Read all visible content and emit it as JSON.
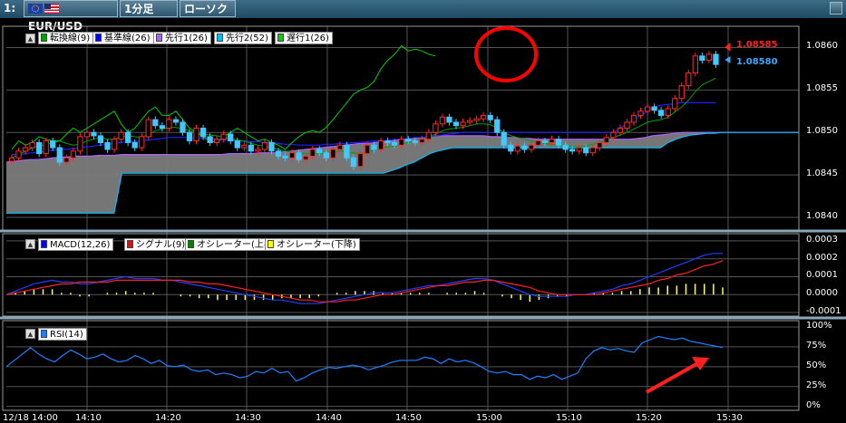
{
  "toolbar": {
    "window_index": "1:",
    "symbol": "EUR/USD",
    "timeframe": "1分足",
    "chart_style": "ローソク"
  },
  "chart_data": [
    {
      "type": "candlestick",
      "title": "EUR/USD",
      "ylim": [
        1.08385,
        1.08625
      ],
      "yticks": [
        "1.0860",
        "1.0855",
        "1.0850",
        "1.0845",
        "1.0840"
      ],
      "x_ticks": [
        "12/18 14:00",
        "14:10",
        "14:20",
        "14:30",
        "14:40",
        "14:50",
        "15:00",
        "15:10",
        "15:20",
        "15:30"
      ],
      "legend": [
        {
          "name": "転換線(9)",
          "color": "#00a000"
        },
        {
          "name": "基準線(26)",
          "color": "#0000ff"
        },
        {
          "name": "先行1(26)",
          "color": "#b060ff"
        },
        {
          "name": "先行2(52)",
          "color": "#00c0ff"
        },
        {
          "name": "遅行1(26)",
          "color": "#00d000"
        }
      ],
      "price_labels": [
        {
          "text": "1.08585",
          "color": "#ff2020"
        },
        {
          "text": "1.08580",
          "color": "#3aa8ff"
        }
      ],
      "close": [
        1.0847,
        1.08478,
        1.08482,
        1.08488,
        1.08475,
        1.0849,
        1.08482,
        1.08465,
        1.0847,
        1.08478,
        1.08495,
        1.085,
        1.08496,
        1.08488,
        1.0848,
        1.08492,
        1.085,
        1.08488,
        1.08482,
        1.08495,
        1.08515,
        1.08508,
        1.08505,
        1.08515,
        1.08512,
        1.085,
        1.0849,
        1.08505,
        1.08495,
        1.08488,
        1.08492,
        1.08498,
        1.0849,
        1.08482,
        1.08485,
        1.08478,
        1.0848,
        1.08488,
        1.08478,
        1.08472,
        1.0847,
        1.08476,
        1.08468,
        1.08472,
        1.0848,
        1.08476,
        1.0847,
        1.0848,
        1.08485,
        1.0847,
        1.0846,
        1.08475,
        1.08485,
        1.0848,
        1.0849,
        1.08488,
        1.08485,
        1.08492,
        1.0849,
        1.08488,
        1.08492,
        1.085,
        1.0851,
        1.08518,
        1.08512,
        1.08508,
        1.08512,
        1.08514,
        1.08516,
        1.0852,
        1.08515,
        1.085,
        1.08485,
        1.08478,
        1.08484,
        1.0848,
        1.08485,
        1.0849,
        1.08488,
        1.08492,
        1.08485,
        1.0848,
        1.08478,
        1.08482,
        1.08476,
        1.08482,
        1.08488,
        1.08494,
        1.085,
        1.08505,
        1.08512,
        1.0852,
        1.08525,
        1.0853,
        1.08526,
        1.0852,
        1.08528,
        1.0854,
        1.08555,
        1.0857,
        1.0859,
        1.08585,
        1.08592,
        1.0858
      ],
      "tenkan": [
        1.0847,
        1.08474,
        1.08478,
        1.08482,
        1.08484,
        1.08486,
        1.08488,
        1.0849,
        1.08487,
        1.08485,
        1.08486,
        1.0849,
        1.08492,
        1.08494,
        1.08492,
        1.08492,
        1.08495,
        1.08496,
        1.08495,
        1.08494,
        1.08498,
        1.08502,
        1.08504,
        1.08506,
        1.08506,
        1.08504,
        1.08502,
        1.085,
        1.08498,
        1.08497,
        1.08496,
        1.08494,
        1.08493,
        1.08491,
        1.0849,
        1.08487,
        1.08485,
        1.08484,
        1.08482,
        1.0848,
        1.08478,
        1.08477,
        1.08476,
        1.08475,
        1.08475,
        1.08475,
        1.08476,
        1.08477,
        1.08478,
        1.08477,
        1.08476,
        1.08475,
        1.08477,
        1.08479,
        1.08481,
        1.08483,
        1.08484,
        1.08486,
        1.08488,
        1.0849,
        1.08492,
        1.08494,
        1.08498,
        1.08502,
        1.08504,
        1.08505,
        1.08506,
        1.08508,
        1.0851,
        1.0851,
        1.08509,
        1.08505,
        1.085,
        1.08496,
        1.08494,
        1.08492,
        1.0849,
        1.08488,
        1.08487,
        1.08486,
        1.08485,
        1.08484,
        1.08483,
        1.08483,
        1.08484,
        1.08486,
        1.08488,
        1.08491,
        1.08494,
        1.08497,
        1.085,
        1.08504,
        1.08508,
        1.08512,
        1.08514,
        1.08515,
        1.08518,
        1.08524,
        1.0853,
        1.08538,
        1.08548,
        1.08556,
        1.0856,
        1.08564
      ],
      "kijun": [
        1.08474,
        1.08474,
        1.08475,
        1.08476,
        1.08477,
        1.08478,
        1.08479,
        1.0848,
        1.0848,
        1.08481,
        1.08482,
        1.08483,
        1.08484,
        1.08485,
        1.08486,
        1.08487,
        1.08488,
        1.08489,
        1.08489,
        1.0849,
        1.08491,
        1.08492,
        1.08493,
        1.08494,
        1.08494,
        1.08494,
        1.08494,
        1.08493,
        1.08493,
        1.08492,
        1.08492,
        1.08491,
        1.08491,
        1.0849,
        1.0849,
        1.08489,
        1.08489,
        1.08488,
        1.08488,
        1.08487,
        1.08486,
        1.08486,
        1.08485,
        1.08485,
        1.08485,
        1.08485,
        1.08486,
        1.08486,
        1.08487,
        1.08487,
        1.08488,
        1.08488,
        1.08489,
        1.0849,
        1.0849,
        1.08491,
        1.08492,
        1.08492,
        1.08493,
        1.08494,
        1.08494,
        1.08495,
        1.08496,
        1.08497,
        1.08498,
        1.08499,
        1.085,
        1.085,
        1.085,
        1.085,
        1.085,
        1.085,
        1.085,
        1.085,
        1.085,
        1.085,
        1.085,
        1.085,
        1.085,
        1.085,
        1.085,
        1.085,
        1.085,
        1.085,
        1.085,
        1.085,
        1.085,
        1.085,
        1.085,
        1.08505,
        1.0851,
        1.08515,
        1.0852,
        1.08525,
        1.0853,
        1.08532,
        1.08533,
        1.08534,
        1.08535,
        1.08535,
        1.08535,
        1.08535,
        1.08535,
        1.08535
      ],
      "senkou1": [
        1.08465,
        1.08466,
        1.08467,
        1.08468,
        1.08468,
        1.08469,
        1.0847,
        1.08471,
        1.08471,
        1.08472,
        1.08472,
        1.08472,
        1.08473,
        1.08473,
        1.08473,
        1.08474,
        1.08474,
        1.08474,
        1.08474,
        1.08474,
        1.08474,
        1.08474,
        1.08474,
        1.08474,
        1.08474,
        1.08474,
        1.08474,
        1.08474,
        1.08474,
        1.08475,
        1.08475,
        1.08475,
        1.08475,
        1.08476,
        1.08476,
        1.08476,
        1.08477,
        1.08478,
        1.08479,
        1.0848,
        1.08481,
        1.08482,
        1.08483,
        1.08484,
        1.08485,
        1.08486,
        1.08487,
        1.08487,
        1.08488,
        1.08489,
        1.0849,
        1.08491,
        1.08492,
        1.08493,
        1.08494,
        1.08495,
        1.08496,
        1.08496,
        1.08496,
        1.08496,
        1.08496,
        1.08496,
        1.08496,
        1.08495,
        1.08495,
        1.08494,
        1.08494,
        1.08493,
        1.08493,
        1.08492,
        1.08492,
        1.08492,
        1.08492,
        1.08492,
        1.08492,
        1.08492,
        1.08492,
        1.08492,
        1.08492,
        1.08492,
        1.08492,
        1.08492,
        1.08493,
        1.08494,
        1.08496,
        1.08497,
        1.08498,
        1.08499,
        1.085,
        1.085,
        1.085,
        1.085,
        1.085,
        1.085,
        1.085,
        1.085,
        1.085,
        1.085,
        1.085,
        1.085,
        1.085,
        1.085,
        1.085,
        1.085
      ],
      "senkou2": [
        1.08405,
        1.08405,
        1.08405,
        1.08405,
        1.08405,
        1.08405,
        1.08405,
        1.08405,
        1.08405,
        1.08405,
        1.08405,
        1.08405,
        1.08405,
        1.08405,
        1.08405,
        1.08452,
        1.08452,
        1.08452,
        1.08452,
        1.08452,
        1.08452,
        1.08452,
        1.08452,
        1.08452,
        1.08452,
        1.08452,
        1.08452,
        1.08452,
        1.08452,
        1.08452,
        1.08452,
        1.08452,
        1.08452,
        1.08452,
        1.08452,
        1.08452,
        1.08452,
        1.08452,
        1.08452,
        1.08452,
        1.08452,
        1.08452,
        1.08452,
        1.08452,
        1.08452,
        1.08452,
        1.08452,
        1.08452,
        1.08452,
        1.08452,
        1.08455,
        1.08458,
        1.08462,
        1.08465,
        1.0847,
        1.08475,
        1.08478,
        1.0848,
        1.08482,
        1.08482,
        1.08482,
        1.08482,
        1.08482,
        1.08482,
        1.08482,
        1.08482,
        1.08482,
        1.08482,
        1.08482,
        1.08482,
        1.08482,
        1.08482,
        1.08482,
        1.08482,
        1.08482,
        1.08482,
        1.08482,
        1.08482,
        1.08482,
        1.08482,
        1.08482,
        1.08482,
        1.08482,
        1.08482,
        1.08482,
        1.08482,
        1.08488,
        1.08492,
        1.08495,
        1.08497,
        1.08498,
        1.08499,
        1.08499,
        1.085,
        1.085,
        1.085,
        1.085,
        1.085,
        1.085,
        1.085,
        1.085,
        1.085,
        1.085,
        1.085
      ],
      "chikou": [
        1.0848,
        1.0849,
        1.08485,
        1.08488,
        1.08495,
        1.08492,
        1.0849,
        1.0849,
        1.08498,
        1.08505,
        1.085,
        1.08505,
        1.0851,
        1.08515,
        1.0852,
        1.08525,
        1.0851,
        1.085,
        1.08505,
        1.08515,
        1.08525,
        1.0853,
        1.0852,
        1.0852,
        1.08525,
        1.08515,
        1.08505,
        1.085,
        1.08495,
        1.0849,
        1.08488,
        1.08495,
        1.085,
        1.08505,
        1.085,
        1.08495,
        1.0849,
        1.08492,
        1.08488,
        1.08485,
        1.0848,
        1.08488,
        1.08495,
        1.085,
        1.08502,
        1.085,
        1.08506,
        1.08515,
        1.08525,
        1.08535,
        1.08545,
        1.0855,
        1.08553,
        1.0856,
        1.08575,
        1.08585,
        1.08592,
        1.08602,
        1.08596,
        1.08598,
        1.08596,
        1.08592,
        1.0859
      ]
    },
    {
      "type": "line",
      "title": "MACD",
      "ylim": [
        -0.00012,
        0.00034
      ],
      "yticks": [
        "0.0003",
        "0.0002",
        "0.0001",
        "0.0000",
        "-0.0001"
      ],
      "legend": [
        {
          "name": "MACD(12,26)",
          "color": "#0000ff"
        },
        {
          "name": "シグナル(9)",
          "color": "#ff0000"
        },
        {
          "name": "オシレーター(上昇)",
          "color": "#008000"
        },
        {
          "name": "オシレーター(下降)",
          "color": "#ffff00"
        }
      ],
      "macd": [
        0.0,
        2e-05,
        4e-05,
        6e-05,
        7e-05,
        8e-05,
        7e-05,
        7e-05,
        6e-05,
        6e-05,
        7e-05,
        8e-05,
        9e-05,
        0.0001,
        9e-05,
        9e-05,
        9e-05,
        8e-05,
        8e-05,
        7e-05,
        6e-05,
        5e-05,
        4e-05,
        3e-05,
        2e-05,
        1e-05,
        0.0,
        -1e-05,
        -2e-05,
        -3e-05,
        -3e-05,
        -4e-05,
        -5e-05,
        -5e-05,
        -5e-05,
        -4e-05,
        -3e-05,
        -2e-05,
        -1e-05,
        0.0,
        1e-05,
        1e-05,
        1e-05,
        2e-05,
        3e-05,
        4e-05,
        5e-05,
        5e-05,
        6e-05,
        7e-05,
        8e-05,
        9e-05,
        9e-05,
        8e-05,
        6e-05,
        4e-05,
        2e-05,
        0.0,
        -1e-05,
        -1e-05,
        -1e-05,
        -1e-05,
        0.0,
        0.0,
        1e-05,
        2e-05,
        3e-05,
        5e-05,
        6e-05,
        8e-05,
        0.0001,
        0.00012,
        0.00014,
        0.00016,
        0.00018,
        0.0002,
        0.00022,
        0.00023,
        0.00023
      ],
      "signal": [
        0.0,
        1e-05,
        2e-05,
        3e-05,
        4e-05,
        5e-05,
        6e-05,
        6e-05,
        7e-05,
        7e-05,
        7e-05,
        7e-05,
        8e-05,
        8e-05,
        8e-05,
        8e-05,
        8e-05,
        8e-05,
        8e-05,
        8e-05,
        7e-05,
        7e-05,
        6e-05,
        6e-05,
        5e-05,
        4e-05,
        3e-05,
        2e-05,
        1e-05,
        0.0,
        -1e-05,
        -2e-05,
        -3e-05,
        -3e-05,
        -4e-05,
        -4e-05,
        -4e-05,
        -3e-05,
        -3e-05,
        -2e-05,
        -1e-05,
        0.0,
        0.0,
        1e-05,
        2e-05,
        3e-05,
        4e-05,
        5e-05,
        5e-05,
        6e-05,
        7e-05,
        7e-05,
        8e-05,
        8e-05,
        7e-05,
        6e-05,
        5e-05,
        4e-05,
        2e-05,
        1e-05,
        0.0,
        0.0,
        0.0,
        0.0,
        0.0,
        1e-05,
        2e-05,
        3e-05,
        4e-05,
        5e-05,
        6e-05,
        8e-05,
        9e-05,
        0.00011,
        0.00012,
        0.00014,
        0.00016,
        0.00017,
        0.00019
      ],
      "histogram": [
        0.0,
        1e-05,
        2e-05,
        3e-05,
        3e-05,
        3e-05,
        1e-05,
        1e-05,
        -1e-05,
        -1e-05,
        0.0,
        1e-05,
        1e-05,
        2e-05,
        1e-05,
        1e-05,
        1e-05,
        0.0,
        0.0,
        -1e-05,
        -1e-05,
        -2e-05,
        -2e-05,
        -3e-05,
        -3e-05,
        -3e-05,
        -3e-05,
        -3e-05,
        -3e-05,
        -3e-05,
        -2e-05,
        -2e-05,
        -2e-05,
        -2e-05,
        -1e-05,
        0.0,
        1e-05,
        1e-05,
        2e-05,
        2e-05,
        2e-05,
        1e-05,
        1e-05,
        1e-05,
        1e-05,
        1e-05,
        1e-05,
        0.0,
        1e-05,
        1e-05,
        1e-05,
        2e-05,
        1e-05,
        0.0,
        -1e-05,
        -2e-05,
        -3e-05,
        -4e-05,
        -3e-05,
        -2e-05,
        -1e-05,
        -1e-05,
        0.0,
        0.0,
        1e-05,
        1e-05,
        1e-05,
        2e-05,
        2e-05,
        3e-05,
        4e-05,
        4e-05,
        5e-05,
        5e-05,
        6e-05,
        6e-05,
        6e-05,
        6e-05,
        4e-05
      ]
    },
    {
      "type": "line",
      "title": "RSI",
      "ylim": [
        -5,
        108
      ],
      "yticks": [
        "100%",
        "75%",
        "50%",
        "25%",
        "0%"
      ],
      "legend": [
        {
          "name": "RSI(14)",
          "color": "#2080ff"
        }
      ],
      "rsi": [
        50,
        58,
        66,
        74,
        66,
        60,
        56,
        64,
        71,
        66,
        60,
        62,
        66,
        60,
        56,
        58,
        64,
        60,
        54,
        58,
        51,
        50,
        52,
        46,
        44,
        46,
        40,
        42,
        40,
        36,
        38,
        44,
        42,
        48,
        42,
        44,
        32,
        36,
        42,
        46,
        49,
        48,
        50,
        52,
        50,
        46,
        49,
        52,
        56,
        58,
        58,
        58,
        62,
        60,
        54,
        60,
        56,
        58,
        55,
        50,
        44,
        42,
        44,
        40,
        40,
        34,
        38,
        36,
        40,
        34,
        38,
        42,
        60,
        70,
        74,
        71,
        73,
        70,
        68,
        80,
        84,
        88,
        86,
        84,
        86,
        82,
        80,
        78,
        76,
        74
      ]
    }
  ],
  "annotations": {
    "circle_color": "#ff0000",
    "arrow_color": "#ff2020"
  }
}
